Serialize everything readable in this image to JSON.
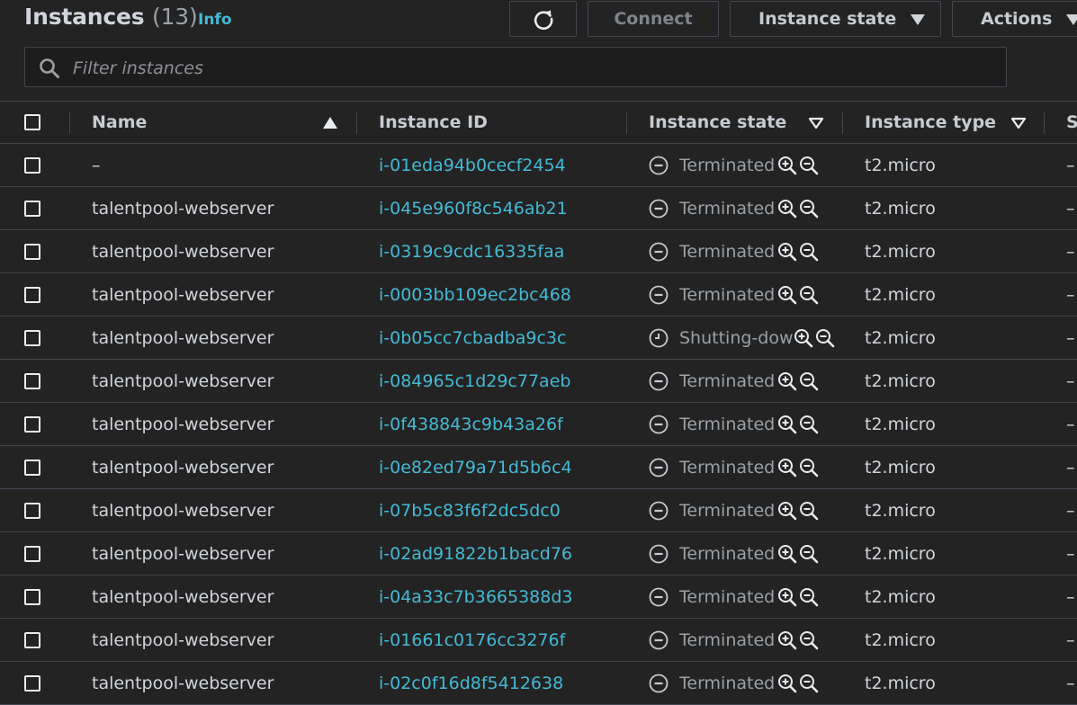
{
  "header": {
    "title": "Instances",
    "count": "(13)",
    "info_label": "Info",
    "refresh_icon": "refresh-icon",
    "connect_label": "Connect",
    "instance_state_label": "Instance state",
    "actions_label": "Actions"
  },
  "search": {
    "placeholder": "Filter instances",
    "value": ""
  },
  "table": {
    "columns": [
      "Name",
      "Instance ID",
      "Instance state",
      "Instance type",
      "S"
    ],
    "rows": [
      {
        "name": "–",
        "id": "i-01eda94b0cecf2454",
        "state": "Terminated",
        "state_kind": "terminated",
        "type": "t2.micro",
        "extra": "–"
      },
      {
        "name": "talentpool-webserver",
        "id": "i-045e960f8c546ab21",
        "state": "Terminated",
        "state_kind": "terminated",
        "type": "t2.micro",
        "extra": "–"
      },
      {
        "name": "talentpool-webserver",
        "id": "i-0319c9cdc16335faa",
        "state": "Terminated",
        "state_kind": "terminated",
        "type": "t2.micro",
        "extra": "–"
      },
      {
        "name": "talentpool-webserver",
        "id": "i-0003bb109ec2bc468",
        "state": "Terminated",
        "state_kind": "terminated",
        "type": "t2.micro",
        "extra": "–"
      },
      {
        "name": "talentpool-webserver",
        "id": "i-0b05cc7cbadba9c3c",
        "state": "Shutting-dow",
        "state_kind": "shutting-down",
        "type": "t2.micro",
        "extra": "–"
      },
      {
        "name": "talentpool-webserver",
        "id": "i-084965c1d29c77aeb",
        "state": "Terminated",
        "state_kind": "terminated",
        "type": "t2.micro",
        "extra": "–"
      },
      {
        "name": "talentpool-webserver",
        "id": "i-0f438843c9b43a26f",
        "state": "Terminated",
        "state_kind": "terminated",
        "type": "t2.micro",
        "extra": "–"
      },
      {
        "name": "talentpool-webserver",
        "id": "i-0e82ed79a71d5b6c4",
        "state": "Terminated",
        "state_kind": "terminated",
        "type": "t2.micro",
        "extra": "–"
      },
      {
        "name": "talentpool-webserver",
        "id": "i-07b5c83f6f2dc5dc0",
        "state": "Terminated",
        "state_kind": "terminated",
        "type": "t2.micro",
        "extra": "–"
      },
      {
        "name": "talentpool-webserver",
        "id": "i-02ad91822b1bacd76",
        "state": "Terminated",
        "state_kind": "terminated",
        "type": "t2.micro",
        "extra": "–"
      },
      {
        "name": "talentpool-webserver",
        "id": "i-04a33c7b3665388d3",
        "state": "Terminated",
        "state_kind": "terminated",
        "type": "t2.micro",
        "extra": "–"
      },
      {
        "name": "talentpool-webserver",
        "id": "i-01661c0176cc3276f",
        "state": "Terminated",
        "state_kind": "terminated",
        "type": "t2.micro",
        "extra": "–"
      },
      {
        "name": "talentpool-webserver",
        "id": "i-02c0f16d8f5412638",
        "state": "Terminated",
        "state_kind": "terminated",
        "type": "t2.micro",
        "extra": "–"
      }
    ]
  },
  "colors": {
    "background": "#232323",
    "link": "#44b9d6",
    "border": "#414750",
    "text": "#d1d5db",
    "muted": "#9aa0a6"
  }
}
